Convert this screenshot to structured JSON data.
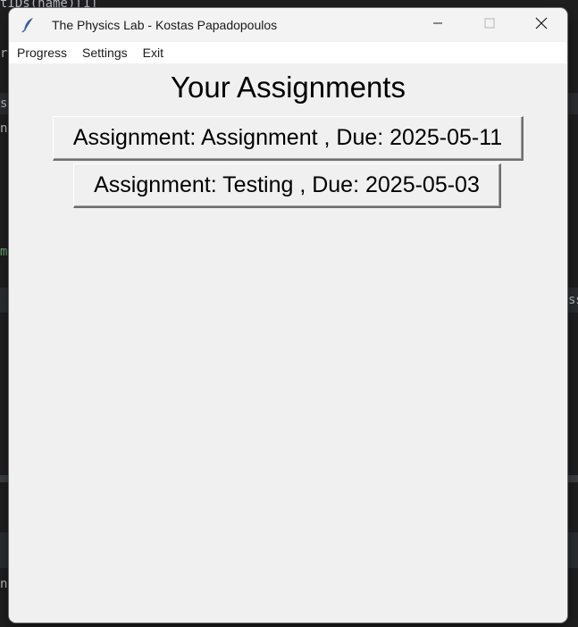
{
  "window": {
    "title": "The Physics Lab - Kostas Papadopoulos"
  },
  "menubar": {
    "items": [
      {
        "label": "Progress"
      },
      {
        "label": "Settings"
      },
      {
        "label": "Exit"
      }
    ]
  },
  "main": {
    "heading": "Your Assignments",
    "assignments": [
      {
        "label": "Assignment: Assignment , Due: 2025-05-11"
      },
      {
        "label": "Assignment: Testing , Due: 2025-05-03"
      }
    ]
  },
  "background_editor": {
    "snippets": [
      "tIDs(name)[1]",
      "r",
      "s",
      "n",
      "m",
      "ss",
      "n."
    ]
  },
  "icons": {
    "app": "feather-icon",
    "minimize": "minimize-icon",
    "maximize": "maximize-icon",
    "close": "close-icon"
  },
  "colors": {
    "window_bg": "#f0f0f0",
    "titlebar_bg": "#f3f3f3",
    "menubar_bg": "#ffffff",
    "editor_bg": "#1f1f1f"
  }
}
